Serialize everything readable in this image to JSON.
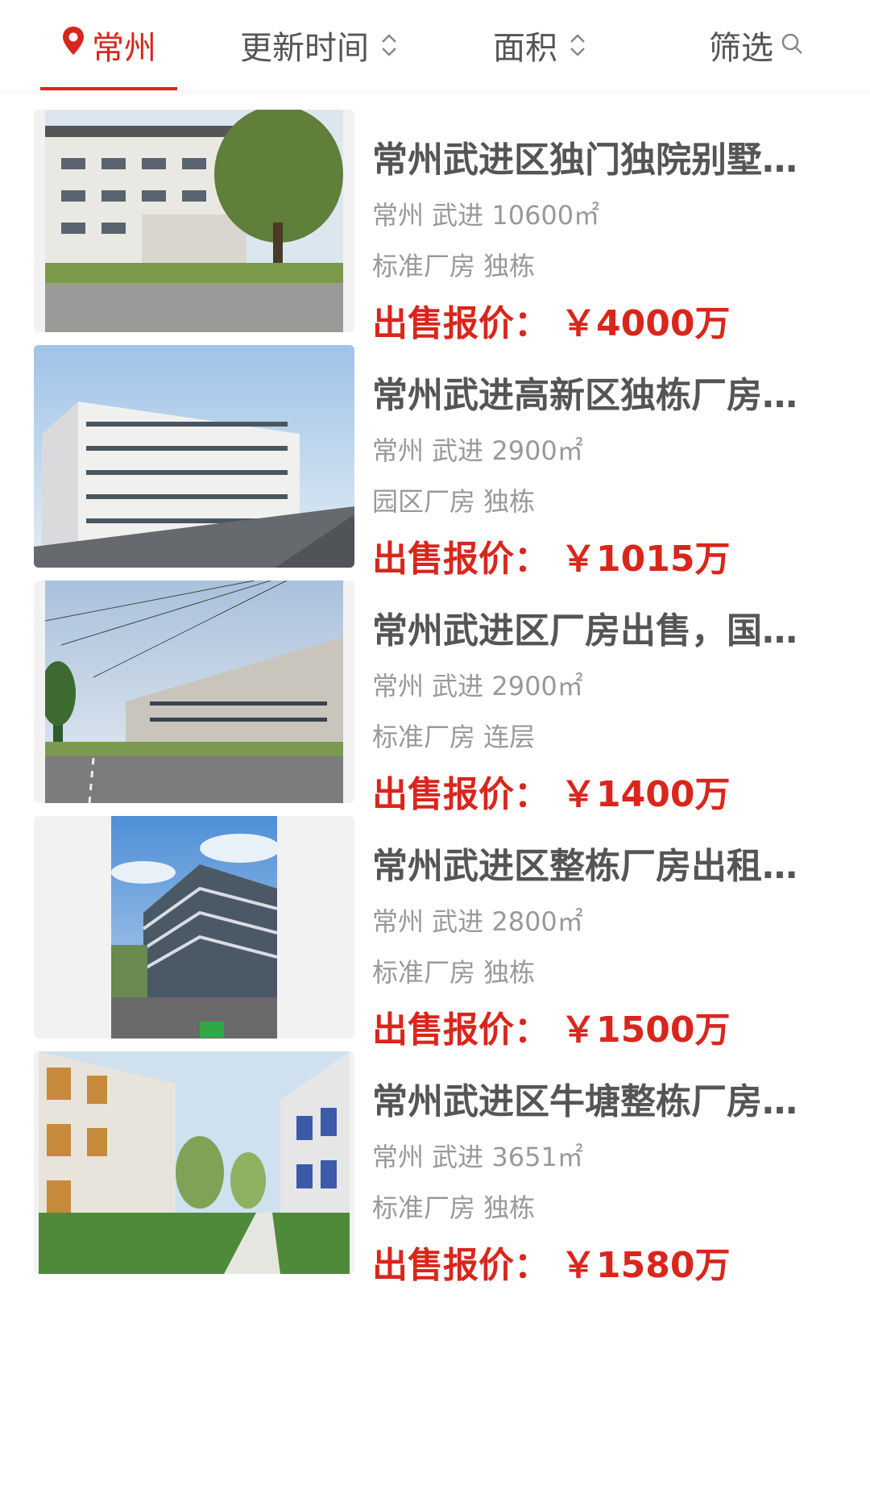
{
  "tabs": {
    "city": "常州",
    "update_time": "更新时间",
    "area": "面积",
    "filter": "筛选"
  },
  "accent_color": "#d9261c",
  "price_label": "出售报价：",
  "listings": [
    {
      "title": "常州武进区独门独院别墅…",
      "location": "常州 武进 10600㎡",
      "tags": "标准厂房 独栋",
      "price": "￥4000万"
    },
    {
      "title": "常州武进高新区独栋厂房…",
      "location": "常州 武进 2900㎡",
      "tags": "园区厂房 独栋",
      "price": "￥1015万"
    },
    {
      "title": "常州武进区厂房出售，国…",
      "location": "常州 武进 2900㎡",
      "tags": "标准厂房 连层",
      "price": "￥1400万"
    },
    {
      "title": "常州武进区整栋厂房出租…",
      "location": "常州 武进 2800㎡",
      "tags": "标准厂房 独栋",
      "price": "￥1500万"
    },
    {
      "title": "常州武进区牛塘整栋厂房…",
      "location": "常州 武进 3651㎡",
      "tags": "标准厂房 独栋",
      "price": "￥1580万"
    }
  ]
}
